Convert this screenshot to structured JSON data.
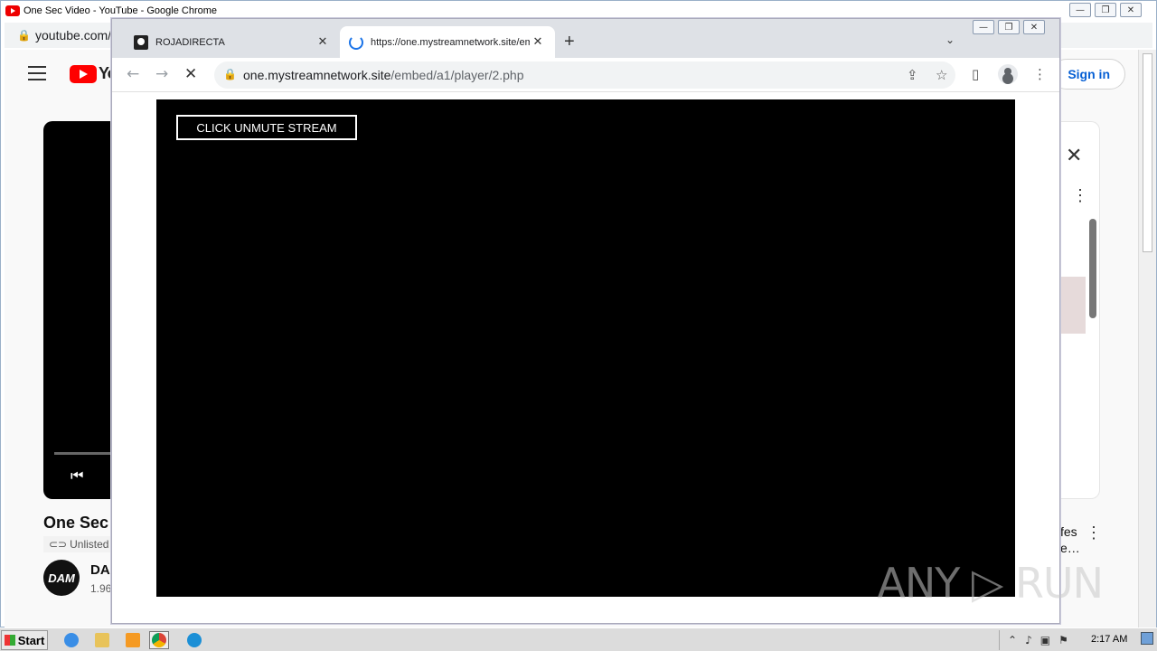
{
  "bg_window": {
    "title": "One Sec Video - YouTube - Google Chrome",
    "url": "youtube.com/",
    "signin_label": "Sign in",
    "logo_text": "Yo",
    "video_title": "One Sec",
    "unlisted_label": "Unlisted",
    "avatar_text": "DAM",
    "channel_name": "DA",
    "subs_text": "1.96",
    "suggestion_text": "fes\ne…"
  },
  "fg_window": {
    "tabs": [
      {
        "label": "ROJADIRECTA"
      },
      {
        "label": "https://one.mystreamnetwork.site/embed/a1/player/2.php"
      }
    ],
    "omnibox": {
      "domain": "one.mystreamnetwork.site",
      "path": "/embed/a1/player/2.php"
    },
    "unmute_label": "CLICK UNMUTE STREAM",
    "watermark": "ANY ▷ RUN"
  },
  "icons": {
    "back": "←",
    "forward": "→",
    "reload": "✕",
    "lock": "🔒",
    "share": "⇪",
    "star": "☆",
    "sidepanel": "▯",
    "menu": "⋮",
    "new_tab": "+",
    "tab_search": "⌄",
    "close": "✕",
    "prev": "⏮"
  },
  "taskbar": {
    "start_label": "Start",
    "clock": "2:17 AM"
  },
  "colors": {
    "accent": "#1a73e8",
    "youtube_red": "#ff0000",
    "player_bg": "#000000"
  }
}
